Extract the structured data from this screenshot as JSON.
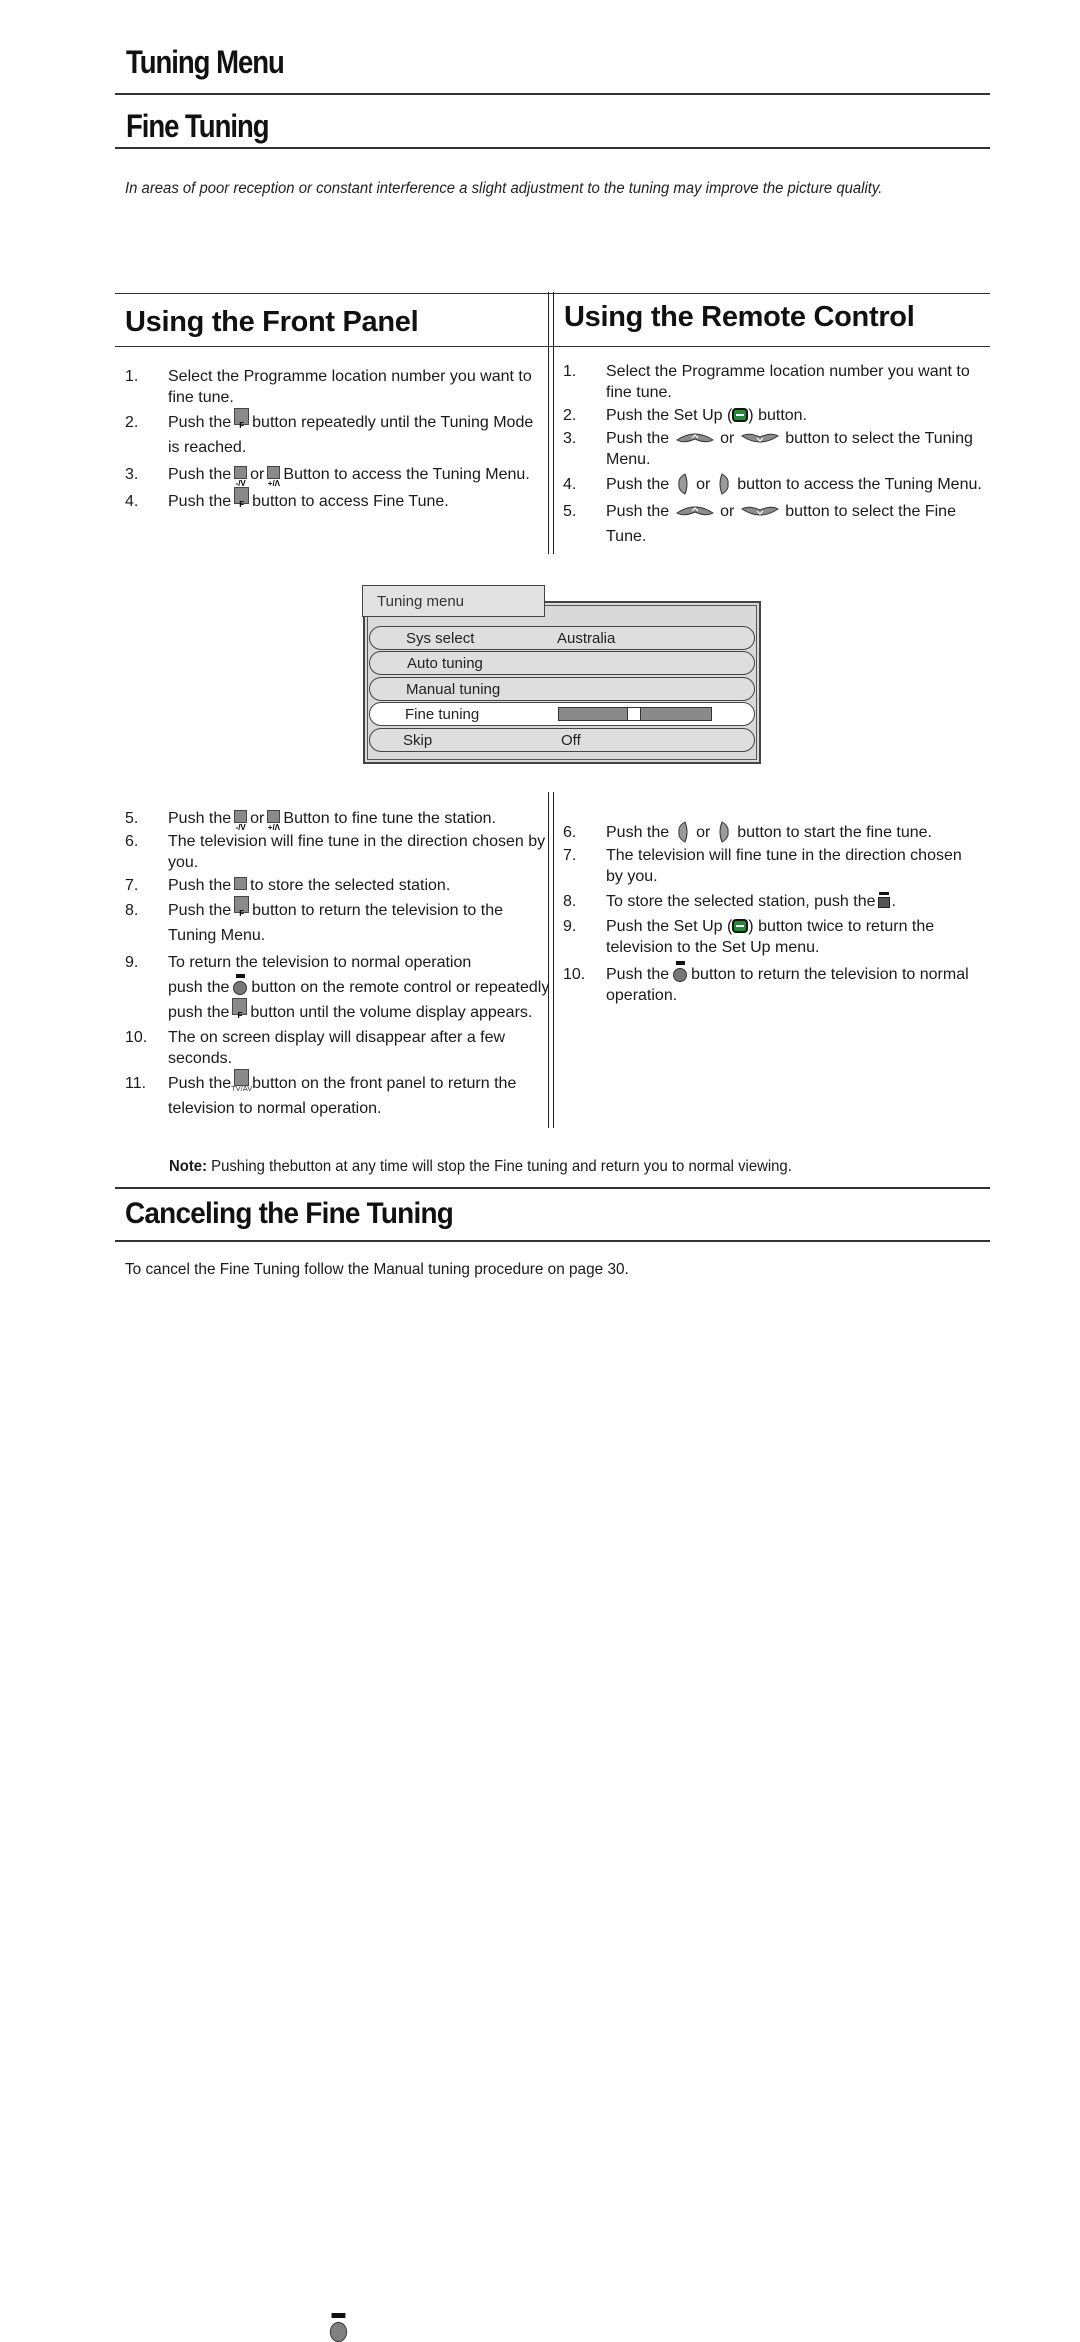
{
  "page": {
    "title": "Tuning Menu",
    "section_title": "Fine Tuning",
    "intro": "In areas of poor reception or constant interference a slight adjustment to the tuning may improve the picture quality."
  },
  "front_panel": {
    "heading": "Using the Front Panel",
    "steps_top": [
      {
        "num": "1.",
        "parts": [
          "Select the Programme location number you want to fine tune."
        ]
      },
      {
        "num": "2.",
        "pre": "Push the",
        "icon": "front-panel-f-button",
        "post": "button repeatedly until the Tuning Mode is reached."
      },
      {
        "num": "3.",
        "pre": "Push the",
        "icon": "front-panel-minus-v-button",
        "mid": "or",
        "icon2": "front-panel-plus-a-button",
        "post": "Button to access the Tuning Menu."
      },
      {
        "num": "4.",
        "pre": "Push the",
        "icon": "front-panel-f-button",
        "post": "button to access Fine Tune."
      }
    ],
    "steps_bottom": [
      {
        "num": "5.",
        "pre": "Push the",
        "mid": "or",
        "post": "Button to fine tune the station."
      },
      {
        "num": "6.",
        "text": "The television will fine tune in the direction chosen by you."
      },
      {
        "num": "7.",
        "pre": "Push the",
        "post": "to store the selected station."
      },
      {
        "num": "8.",
        "pre": "Push the",
        "post": "button to return the television to the Tuning Menu."
      },
      {
        "num": "9.",
        "line1": "To return the television to normal operation",
        "pre": "push the",
        "mid": "button on the remote control or repeatedly push the",
        "post": "button until the volume display appears."
      },
      {
        "num": "10.",
        "text": "The on screen display will disappear after a few seconds."
      },
      {
        "num": "11.",
        "pre": "Push the",
        "post": "button on the front panel to return the television to normal operation."
      }
    ]
  },
  "remote": {
    "heading": "Using the Remote Control",
    "steps_top": [
      {
        "num": "1.",
        "text": "Select the Programme location number you want to fine tune."
      },
      {
        "num": "2.",
        "pre": "Push the Set Up (",
        "post": ") button."
      },
      {
        "num": "3.",
        "pre": "Push the",
        "mid": "or",
        "post": "button to select the Tuning Menu."
      },
      {
        "num": "4.",
        "pre": "Push the",
        "mid": "or",
        "post": "button to access the Tuning Menu."
      },
      {
        "num": "5.",
        "pre": "Push the",
        "mid": "or",
        "post": "button to select the Fine Tune."
      }
    ],
    "steps_bottom": [
      {
        "num": "6.",
        "pre": "Push the",
        "mid": "or",
        "post": "button to start the fine tune."
      },
      {
        "num": "7.",
        "text": "The television will fine tune in the direction chosen by you."
      },
      {
        "num": "8.",
        "pre": "To store the selected station, push the",
        "post": "."
      },
      {
        "num": "9.",
        "pre": "Push the Set Up (",
        "post": ") button twice to return the television to the Set Up menu."
      },
      {
        "num": "10.",
        "pre": "Push the",
        "post": "button to return the television to normal operation."
      }
    ]
  },
  "icon_labels": {
    "f": "F",
    "minus_v": "-/V",
    "plus_a": "+/Λ",
    "tvav": "TV/AV"
  },
  "osd": {
    "title": "Tuning menu",
    "rows": [
      {
        "label": "Sys select",
        "value": "Australia"
      },
      {
        "label": "Auto tuning",
        "value": ""
      },
      {
        "label": "Manual tuning",
        "value": ""
      },
      {
        "label": "Fine tuning",
        "value": "",
        "selected": true,
        "slider_fraction": 0.5
      },
      {
        "label": "Skip",
        "value": "Off"
      }
    ]
  },
  "note": {
    "label": "Note:",
    "pre": "Pushing the",
    "post": "button at any time will stop the Fine tuning and return you to normal viewing."
  },
  "cancel": {
    "heading": "Canceling the Fine Tuning",
    "text": "To cancel the Fine Tuning follow the Manual tuning procedure on page 30."
  },
  "colors": {
    "setup_button": "#1f8a3a",
    "osd_background": "#d9d9d9",
    "slider_track": "#8a8a8a"
  }
}
